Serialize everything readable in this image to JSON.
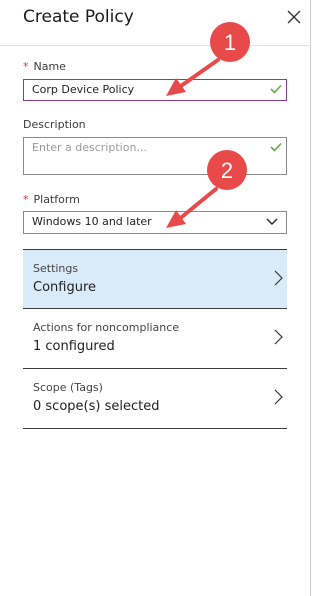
{
  "panel": {
    "title": "Create Policy",
    "close_icon": "close-icon"
  },
  "form": {
    "name": {
      "label": "Name",
      "required_mark": "*",
      "value": "Corp Device Policy",
      "valid": true
    },
    "description": {
      "label": "Description",
      "placeholder": "Enter a description...",
      "value": "",
      "valid": true
    },
    "platform": {
      "label": "Platform",
      "required_mark": "*",
      "selected": "Windows 10 and later"
    }
  },
  "blades": [
    {
      "title": "Settings",
      "value": "Configure",
      "selected": true
    },
    {
      "title": "Actions for noncompliance",
      "value": "1 configured",
      "selected": false
    },
    {
      "title": "Scope (Tags)",
      "value": "0 scope(s) selected",
      "selected": false
    }
  ],
  "annotations": [
    {
      "number": "1"
    },
    {
      "number": "2"
    }
  ],
  "colors": {
    "accent_marker": "#e84a4a",
    "valid_check": "#6aa84f",
    "selected_blade": "#d9ebf8",
    "required": "#d13438"
  }
}
